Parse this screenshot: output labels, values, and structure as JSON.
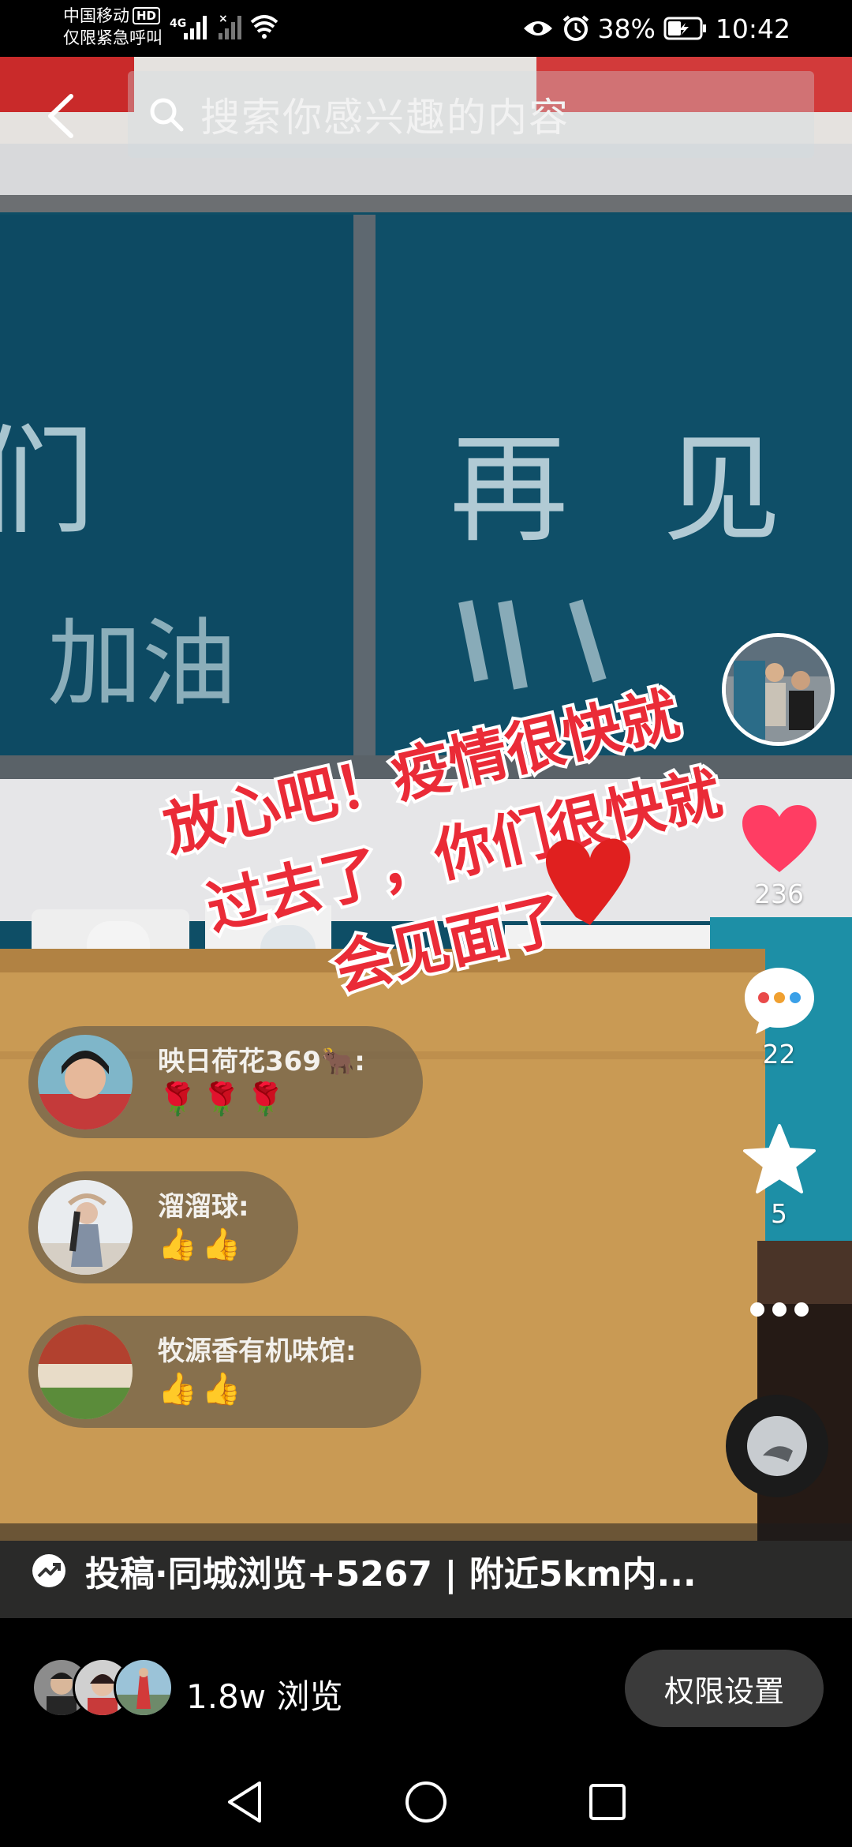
{
  "status_bar": {
    "carrier": "中国移动",
    "hd": "HD",
    "network_type": "4G",
    "emergency_text": "仅限紧急呼叫",
    "battery": "38%",
    "time": "10:42"
  },
  "header": {
    "search_placeholder": "搜索你感兴趣的内容"
  },
  "video_caption": {
    "blackboard_left_top": "们",
    "blackboard_left_bottom": "加油",
    "blackboard_right": "再见",
    "sticker_lines": [
      "放心吧！疫情很快就",
      "过去了，你们很快就",
      "会见面了"
    ]
  },
  "right_rail": {
    "like_count": "236",
    "comment_count": "22",
    "favorite_count": "5"
  },
  "comments": [
    {
      "name": "映日荷花369🐂:",
      "text": "🌹🌹🌹"
    },
    {
      "name": "溜溜球:",
      "text": "👍👍"
    },
    {
      "name": "牧源香有机味馆:",
      "text": "👍👍"
    }
  ],
  "promo": {
    "text": "投稿·同城浏览+5267 | 附近5km内..."
  },
  "bottom_bar": {
    "views": "1.8w 浏览",
    "permission_button": "权限设置"
  },
  "colors": {
    "like_red": "#ff3d63",
    "blackboard": "#0f4f68",
    "sticker_red": "#ea2b37"
  }
}
